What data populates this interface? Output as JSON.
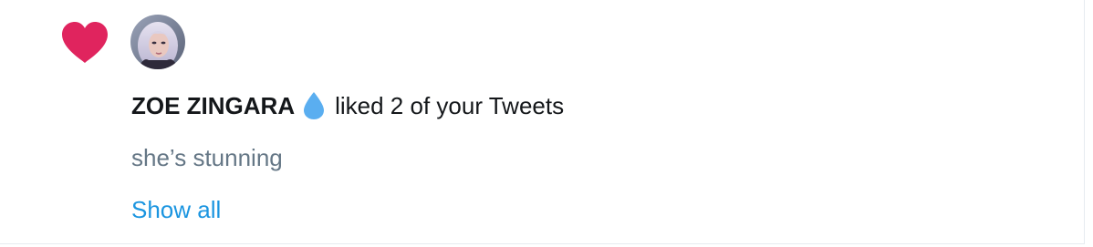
{
  "notification": {
    "type_icon": "heart-icon",
    "avatar_icon": "user-avatar",
    "user_name": "ZOE ZINGARA",
    "user_badge_icon": "water-drop-icon",
    "action_text": "liked 2 of your Tweets",
    "tweet_preview": "she’s stunning",
    "show_all_label": "Show all"
  },
  "colors": {
    "like_heart": "#e0245e",
    "badge_drop": "#5aaef0",
    "primary_text": "#14171a",
    "secondary_text": "#657786",
    "link": "#1b95e0",
    "border": "#e6ecf0"
  }
}
